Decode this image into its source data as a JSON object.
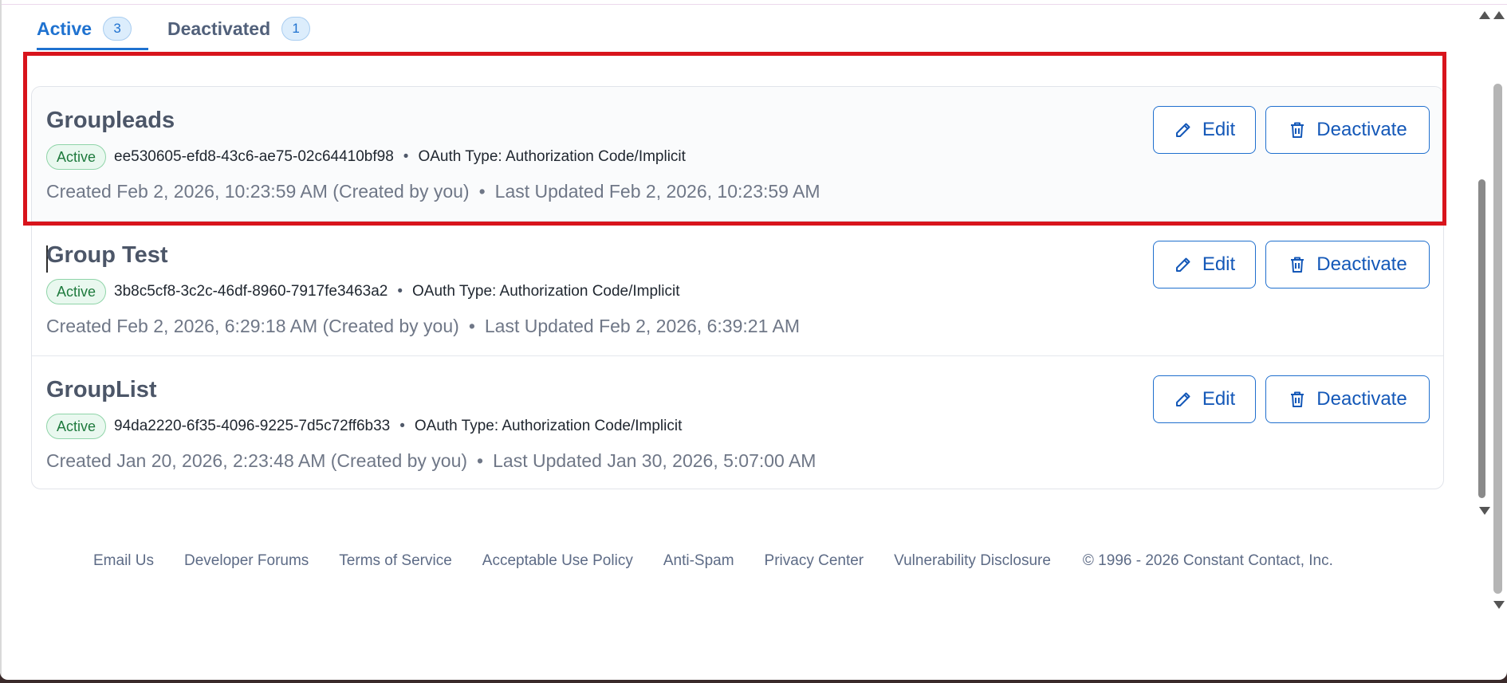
{
  "tabs": [
    {
      "label": "Active",
      "count": "3"
    },
    {
      "label": "Deactivated",
      "count": "1"
    }
  ],
  "apps": [
    {
      "name": "Groupleads",
      "status": "Active",
      "id": "ee530605-efd8-43c6-ae75-02c64410bf98",
      "oauth": "OAuth Type: Authorization Code/Implicit",
      "created": "Created Feb 2, 2026, 10:23:59 AM (Created by you)",
      "updated": "Last Updated Feb 2, 2026, 10:23:59 AM"
    },
    {
      "name": "Group Test",
      "status": "Active",
      "id": "3b8c5cf8-3c2c-46df-8960-7917fe3463a2",
      "oauth": "OAuth Type: Authorization Code/Implicit",
      "created": "Created Feb 2, 2026, 6:29:18 AM (Created by you)",
      "updated": "Last Updated Feb 2, 2026, 6:39:21 AM"
    },
    {
      "name": "GroupList",
      "status": "Active",
      "id": "94da2220-6f35-4096-9225-7d5c72ff6b33",
      "oauth": "OAuth Type: Authorization Code/Implicit",
      "created": "Created Jan 20, 2026, 2:23:48 AM (Created by you)",
      "updated": "Last Updated Jan 30, 2026, 5:07:00 AM"
    }
  ],
  "actions": {
    "edit": "Edit",
    "deactivate": "Deactivate",
    "separator": "•"
  },
  "footer": {
    "links": [
      "Email Us",
      "Developer Forums",
      "Terms of Service",
      "Acceptable Use Policy",
      "Anti-Spam",
      "Privacy Center",
      "Vulnerability Disclosure"
    ],
    "copyright": "© 1996 - 2026 Constant Contact, Inc."
  },
  "colors": {
    "accent": "#1f72d0",
    "highlight": "#d8141c",
    "active_badge": "#1e7a3d"
  },
  "icons": [
    "pencil-icon",
    "trash-icon"
  ]
}
